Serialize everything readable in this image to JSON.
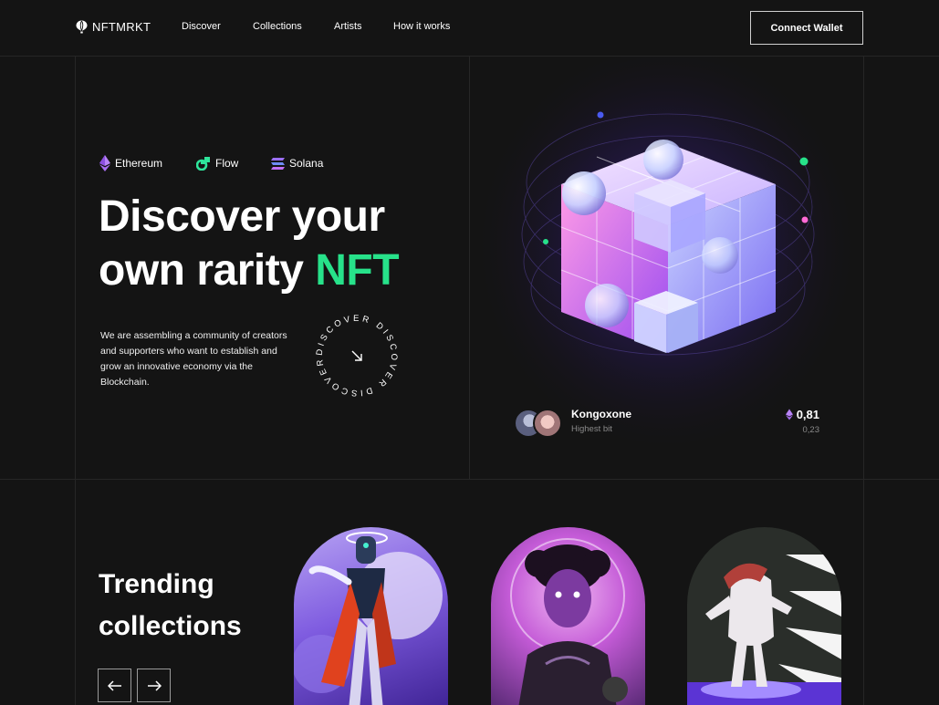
{
  "header": {
    "logo": "NFTMRKT",
    "nav": [
      "Discover",
      "Collections",
      "Artists",
      "How it works"
    ],
    "connect_wallet": "Connect Wallet"
  },
  "hero": {
    "chains": [
      {
        "name": "Ethereum",
        "icon": "ethereum-icon"
      },
      {
        "name": "Flow",
        "icon": "flow-icon"
      },
      {
        "name": "Solana",
        "icon": "solana-icon"
      }
    ],
    "title_line1": "Discover your",
    "title_line2": "own rarity",
    "title_accent": "NFT",
    "description": "We are assembling a community of creators and supporters who want to establish and grow an innovative economy via the Blockchain.",
    "badge_text": "DISCOVER DISCOVER DISCOVER",
    "badge_icon": "arrow-down-right-icon"
  },
  "highest_bid": {
    "name": "Kongoxone",
    "label": "Highest bit",
    "price": "0,81",
    "price_secondary": "0,23",
    "currency_icon": "ethereum-icon"
  },
  "trending": {
    "title_line1": "Trending",
    "title_line2": "collections",
    "prev_icon": "arrow-left-icon",
    "next_icon": "arrow-right-icon"
  },
  "colors": {
    "background": "#141414",
    "accent": "#27e28a",
    "ethereum": "#a86df2",
    "solana": "#8f6ff0"
  }
}
